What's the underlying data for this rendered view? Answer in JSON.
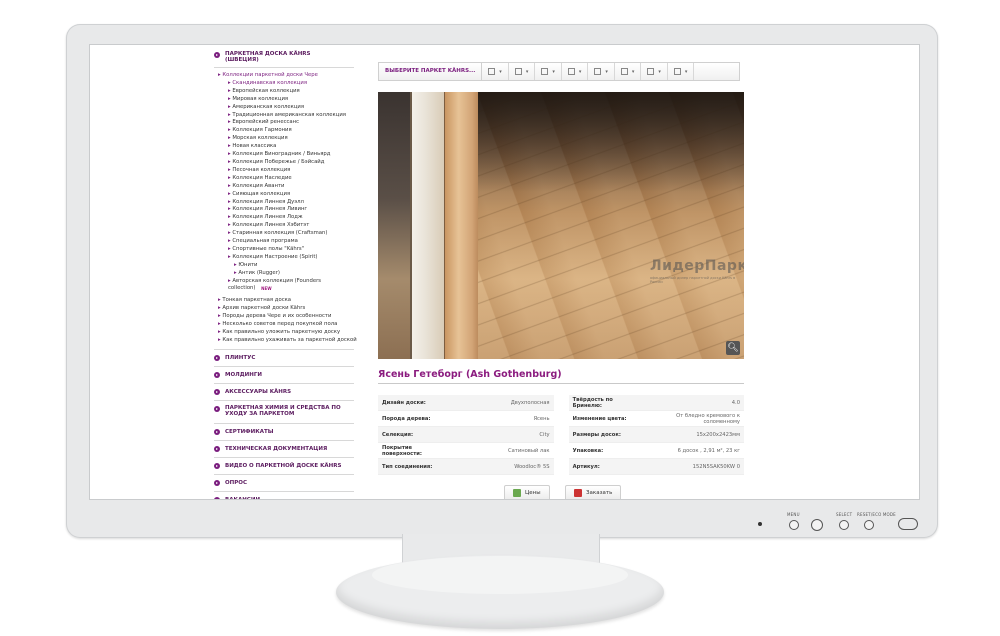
{
  "monitor": {
    "controls": [
      "MENU",
      "SELECT",
      "RESET/ECO MODE"
    ]
  },
  "sidebar": {
    "section1_title": "ПАРКЕТНАЯ ДОСКА KÄHRS (ШВЕЦИЯ)",
    "collections_link": "Коллекции паркетной доски Чере",
    "collections": [
      "Скандинавская коллекция",
      "Европейская коллекция",
      "Мировая коллекция",
      "Американская коллекция",
      "Традиционная американская коллекция",
      "Европейский ренессанс",
      "Коллекция Гармония",
      "Морская коллекция",
      "Новая классика",
      "Коллекция Виноградник / Виньярд",
      "Коллекция Побережье / Бэйсайд",
      "Песочная коллекция",
      "Коллекция Наследие",
      "Коллекция Аванти",
      "Сияющая коллекция",
      "Коллекция Линнея Дуэлл",
      "Коллекция Линнея Ливинг",
      "Коллекция Линнея Лодж",
      "Коллекция Линнея Хэбитэт",
      "Старинная коллекция (Craftsman)",
      "Специальная програма",
      "Спортивные полы \"Kährs\"",
      "Коллекция Настроение (Spirit)"
    ],
    "spirit_sub": [
      "Юнити",
      "Антик (Rugger)"
    ],
    "author_collection": "Авторская коллекция (Founders collection)",
    "new_badge": "NEW",
    "other_links": [
      "Тонкая паркетная доска",
      "Архив паркетной доски Kährs",
      "Породы дерева Чере и их особенности",
      "Несколько советов перед покупкой пола",
      "Как правильно уложить паркетную доску",
      "Как правильно ухаживать за паркетной доской"
    ],
    "main_sections": [
      "ПЛИНТУС",
      "МОЛДИНГИ",
      "АКСЕССУАРЫ KÄHRS",
      "ПАРКЕТНАЯ ХИМИЯ И СРЕДСТВА ПО УХОДУ ЗА ПАРКЕТОМ",
      "СЕРТИФИКАТЫ",
      "ТЕХНИЧЕСКАЯ ДОКУМЕНТАЦИЯ",
      "ВИДЕО О ПАРКЕТНОЙ ДОСКЕ KÄHRS",
      "ОПРОС",
      "ВАКАНСИИ"
    ]
  },
  "toolbar": {
    "select_label": "ВЫБЕРИТЕ ПАРКЕТ KÄHRS..."
  },
  "photo": {
    "watermark": "ЛидерПаркет",
    "watermark_sub": "официальный дилер паркетной доски Kährs в России"
  },
  "product": {
    "title": "Ясень Гетеборг (Ash Gothenburg)",
    "specs": [
      {
        "k1": "Дизайн доски:",
        "v1": "Двухполосная",
        "k2": "Твёрдость по Бринелю:",
        "v2": "4.0"
      },
      {
        "k1": "Порода дерева:",
        "v1": "Ясень",
        "k2": "Изменение цвета:",
        "v2": "От бледно кремового к соломенному"
      },
      {
        "k1": "Селекция:",
        "v1": "City",
        "k2": "Размеры досок:",
        "v2": "15x200x2423мм"
      },
      {
        "k1": "Покрытие поверхности:",
        "v1": "Сатиновый лак",
        "k2": "Упаковка:",
        "v2": "6 досок , 2,91 м², 23 кг"
      },
      {
        "k1": "Тип соединения:",
        "v1": "Woodloc® 5S",
        "k2": "Артикул:",
        "v2": "152N5SAK50KW 0"
      }
    ],
    "btn_prices": "Цены",
    "btn_order": "Заказать"
  }
}
